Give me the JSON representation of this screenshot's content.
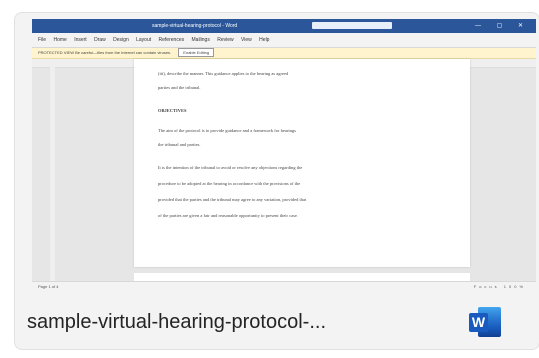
{
  "file": {
    "name": "sample-virtual-hearing-protocol-...",
    "app_icon": "word-icon",
    "app_letter": "W",
    "app_color": "#185abd"
  },
  "preview": {
    "window_title": "sample-virtual-hearing-protocol - Word",
    "menu_items": [
      "File",
      "Home",
      "Insert",
      "Draw",
      "Design",
      "Layout",
      "References",
      "Mailings",
      "Review",
      "View",
      "Help"
    ],
    "infobar_text": "PROTECTED VIEW  Be careful—files from the Internet can contain viruses.",
    "infobar_button": "Enable Editing",
    "page_lines": {
      "line1": "(iii), describe the manner. This guidance applies to the hearing as agreed",
      "line2": "parties and the tribunal.",
      "heading": "OBJECTIVES",
      "line3": "The aim of the protocol is to provide guidance and a framework for hearings",
      "line4": "the tribunal and parties.",
      "line5": "It is the intention of the tribunal to avoid or resolve any objections regarding the",
      "line6": "procedure to be adopted at the hearing in accordance with the provisions of the",
      "line7": "provided that the parties and the tribunal may agree to any variation, provided that",
      "line8": "of the parties are given a fair and reasonable opportunity to present their case."
    },
    "status_left": "Page 1 of 4",
    "status_right": "Focus  100%"
  }
}
